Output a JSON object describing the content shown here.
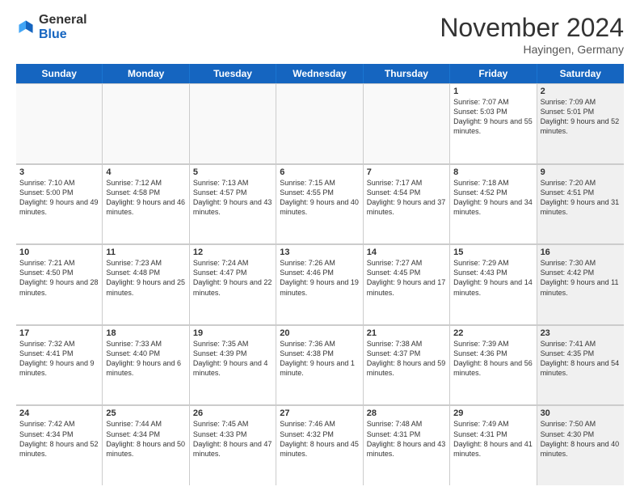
{
  "header": {
    "logo_general": "General",
    "logo_blue": "Blue",
    "month_title": "November 2024",
    "location": "Hayingen, Germany"
  },
  "days_of_week": [
    "Sunday",
    "Monday",
    "Tuesday",
    "Wednesday",
    "Thursday",
    "Friday",
    "Saturday"
  ],
  "rows": [
    [
      {
        "day": "",
        "info": "",
        "empty": true
      },
      {
        "day": "",
        "info": "",
        "empty": true
      },
      {
        "day": "",
        "info": "",
        "empty": true
      },
      {
        "day": "",
        "info": "",
        "empty": true
      },
      {
        "day": "",
        "info": "",
        "empty": true
      },
      {
        "day": "1",
        "info": "Sunrise: 7:07 AM\nSunset: 5:03 PM\nDaylight: 9 hours\nand 55 minutes.",
        "empty": false,
        "shaded": false
      },
      {
        "day": "2",
        "info": "Sunrise: 7:09 AM\nSunset: 5:01 PM\nDaylight: 9 hours\nand 52 minutes.",
        "empty": false,
        "shaded": true
      }
    ],
    [
      {
        "day": "3",
        "info": "Sunrise: 7:10 AM\nSunset: 5:00 PM\nDaylight: 9 hours\nand 49 minutes.",
        "empty": false,
        "shaded": false
      },
      {
        "day": "4",
        "info": "Sunrise: 7:12 AM\nSunset: 4:58 PM\nDaylight: 9 hours\nand 46 minutes.",
        "empty": false,
        "shaded": false
      },
      {
        "day": "5",
        "info": "Sunrise: 7:13 AM\nSunset: 4:57 PM\nDaylight: 9 hours\nand 43 minutes.",
        "empty": false,
        "shaded": false
      },
      {
        "day": "6",
        "info": "Sunrise: 7:15 AM\nSunset: 4:55 PM\nDaylight: 9 hours\nand 40 minutes.",
        "empty": false,
        "shaded": false
      },
      {
        "day": "7",
        "info": "Sunrise: 7:17 AM\nSunset: 4:54 PM\nDaylight: 9 hours\nand 37 minutes.",
        "empty": false,
        "shaded": false
      },
      {
        "day": "8",
        "info": "Sunrise: 7:18 AM\nSunset: 4:52 PM\nDaylight: 9 hours\nand 34 minutes.",
        "empty": false,
        "shaded": false
      },
      {
        "day": "9",
        "info": "Sunrise: 7:20 AM\nSunset: 4:51 PM\nDaylight: 9 hours\nand 31 minutes.",
        "empty": false,
        "shaded": true
      }
    ],
    [
      {
        "day": "10",
        "info": "Sunrise: 7:21 AM\nSunset: 4:50 PM\nDaylight: 9 hours\nand 28 minutes.",
        "empty": false,
        "shaded": false
      },
      {
        "day": "11",
        "info": "Sunrise: 7:23 AM\nSunset: 4:48 PM\nDaylight: 9 hours\nand 25 minutes.",
        "empty": false,
        "shaded": false
      },
      {
        "day": "12",
        "info": "Sunrise: 7:24 AM\nSunset: 4:47 PM\nDaylight: 9 hours\nand 22 minutes.",
        "empty": false,
        "shaded": false
      },
      {
        "day": "13",
        "info": "Sunrise: 7:26 AM\nSunset: 4:46 PM\nDaylight: 9 hours\nand 19 minutes.",
        "empty": false,
        "shaded": false
      },
      {
        "day": "14",
        "info": "Sunrise: 7:27 AM\nSunset: 4:45 PM\nDaylight: 9 hours\nand 17 minutes.",
        "empty": false,
        "shaded": false
      },
      {
        "day": "15",
        "info": "Sunrise: 7:29 AM\nSunset: 4:43 PM\nDaylight: 9 hours\nand 14 minutes.",
        "empty": false,
        "shaded": false
      },
      {
        "day": "16",
        "info": "Sunrise: 7:30 AM\nSunset: 4:42 PM\nDaylight: 9 hours\nand 11 minutes.",
        "empty": false,
        "shaded": true
      }
    ],
    [
      {
        "day": "17",
        "info": "Sunrise: 7:32 AM\nSunset: 4:41 PM\nDaylight: 9 hours\nand 9 minutes.",
        "empty": false,
        "shaded": false
      },
      {
        "day": "18",
        "info": "Sunrise: 7:33 AM\nSunset: 4:40 PM\nDaylight: 9 hours\nand 6 minutes.",
        "empty": false,
        "shaded": false
      },
      {
        "day": "19",
        "info": "Sunrise: 7:35 AM\nSunset: 4:39 PM\nDaylight: 9 hours\nand 4 minutes.",
        "empty": false,
        "shaded": false
      },
      {
        "day": "20",
        "info": "Sunrise: 7:36 AM\nSunset: 4:38 PM\nDaylight: 9 hours\nand 1 minute.",
        "empty": false,
        "shaded": false
      },
      {
        "day": "21",
        "info": "Sunrise: 7:38 AM\nSunset: 4:37 PM\nDaylight: 8 hours\nand 59 minutes.",
        "empty": false,
        "shaded": false
      },
      {
        "day": "22",
        "info": "Sunrise: 7:39 AM\nSunset: 4:36 PM\nDaylight: 8 hours\nand 56 minutes.",
        "empty": false,
        "shaded": false
      },
      {
        "day": "23",
        "info": "Sunrise: 7:41 AM\nSunset: 4:35 PM\nDaylight: 8 hours\nand 54 minutes.",
        "empty": false,
        "shaded": true
      }
    ],
    [
      {
        "day": "24",
        "info": "Sunrise: 7:42 AM\nSunset: 4:34 PM\nDaylight: 8 hours\nand 52 minutes.",
        "empty": false,
        "shaded": false
      },
      {
        "day": "25",
        "info": "Sunrise: 7:44 AM\nSunset: 4:34 PM\nDaylight: 8 hours\nand 50 minutes.",
        "empty": false,
        "shaded": false
      },
      {
        "day": "26",
        "info": "Sunrise: 7:45 AM\nSunset: 4:33 PM\nDaylight: 8 hours\nand 47 minutes.",
        "empty": false,
        "shaded": false
      },
      {
        "day": "27",
        "info": "Sunrise: 7:46 AM\nSunset: 4:32 PM\nDaylight: 8 hours\nand 45 minutes.",
        "empty": false,
        "shaded": false
      },
      {
        "day": "28",
        "info": "Sunrise: 7:48 AM\nSunset: 4:31 PM\nDaylight: 8 hours\nand 43 minutes.",
        "empty": false,
        "shaded": false
      },
      {
        "day": "29",
        "info": "Sunrise: 7:49 AM\nSunset: 4:31 PM\nDaylight: 8 hours\nand 41 minutes.",
        "empty": false,
        "shaded": false
      },
      {
        "day": "30",
        "info": "Sunrise: 7:50 AM\nSunset: 4:30 PM\nDaylight: 8 hours\nand 40 minutes.",
        "empty": false,
        "shaded": true
      }
    ]
  ]
}
